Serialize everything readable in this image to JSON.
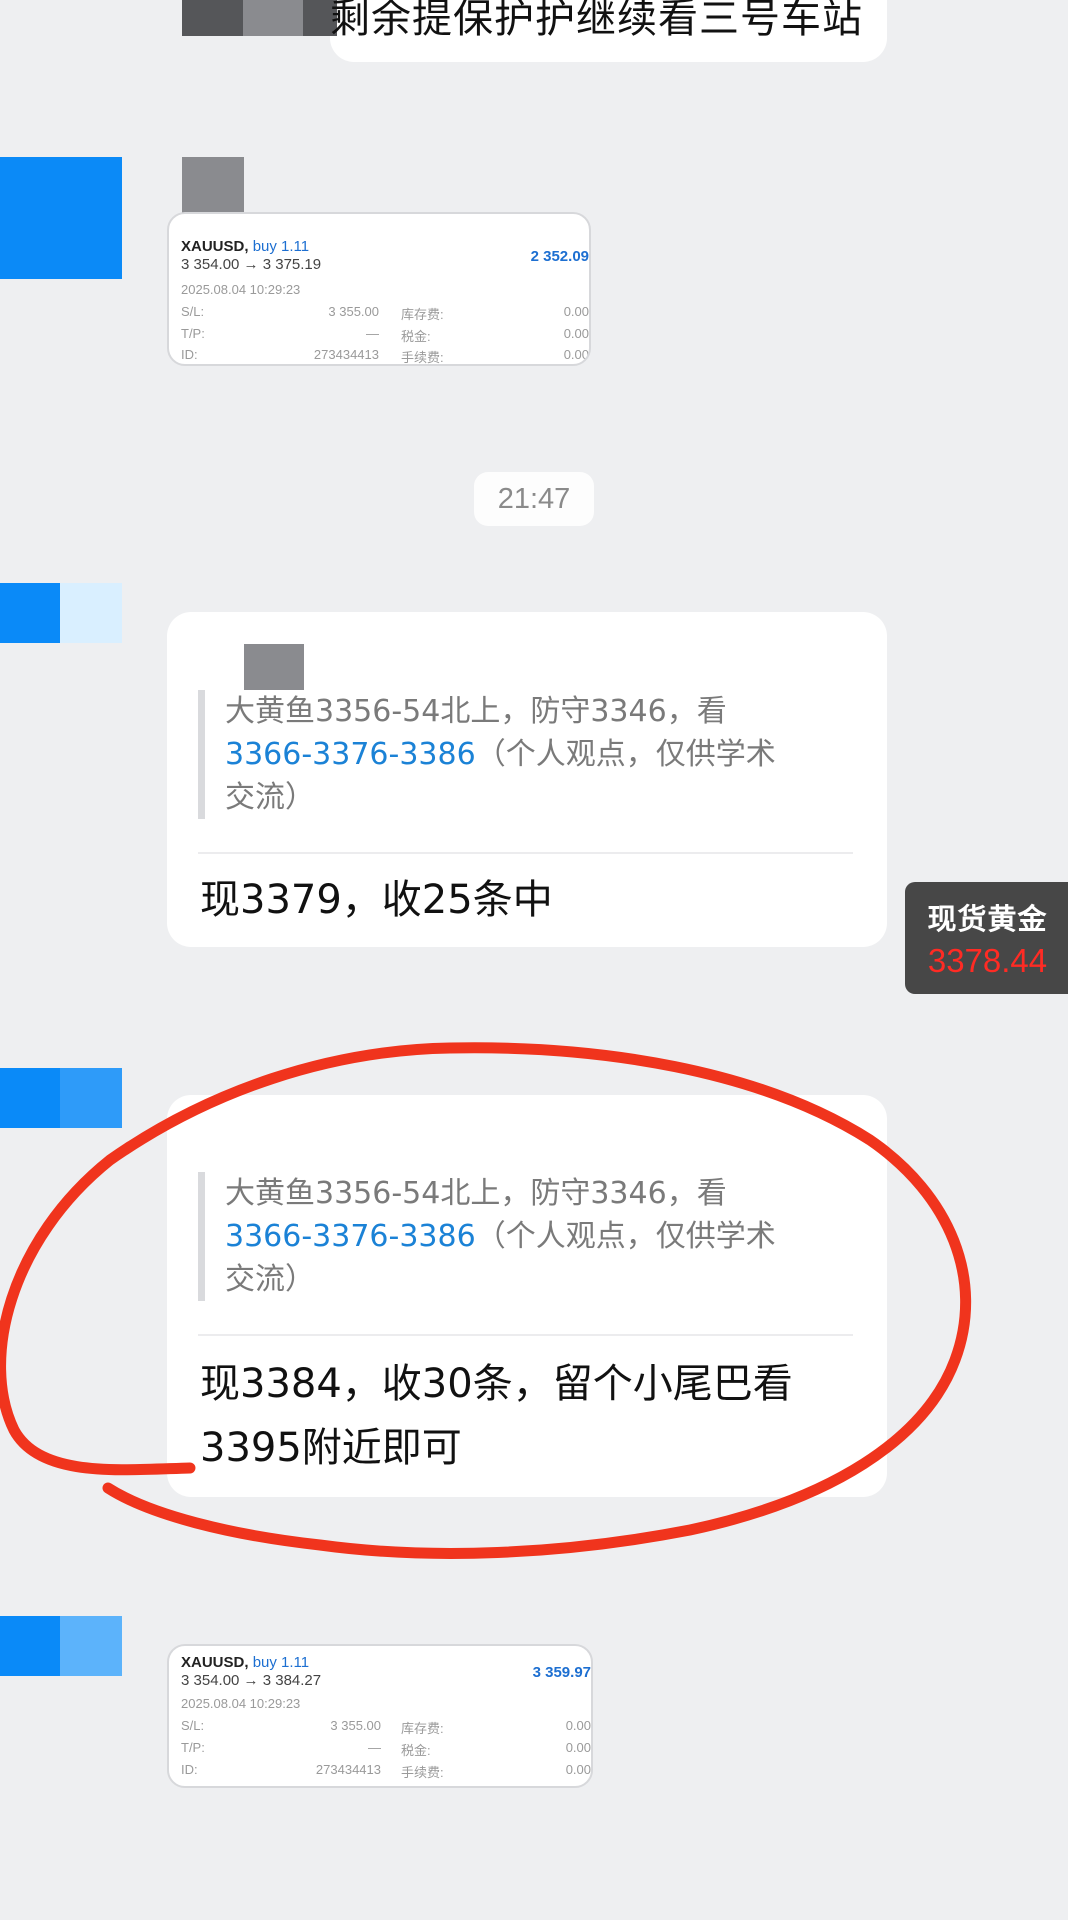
{
  "top_message": {
    "text": "剩余提保护护继续看三号车站"
  },
  "trade_card_1": {
    "symbol": "XAUUSD,",
    "side": "buy 1.11",
    "price": "3 354.00 → 3 375.19",
    "profit": "2 352.09",
    "date": "2025.08.04 10:29:23",
    "rows": [
      {
        "k1": "S/L:",
        "v1": "3 355.00",
        "k2": "库存费:",
        "v2": "0.00"
      },
      {
        "k1": "T/P:",
        "v1": "—",
        "k2": "税金:",
        "v2": "0.00"
      },
      {
        "k1": "ID:",
        "v1": "273434413",
        "k2": "手续费:",
        "v2": "0.00"
      }
    ]
  },
  "time_divider": {
    "time": "21:47"
  },
  "reply_1": {
    "quote_line1": "大黄鱼3356-54北上，防守3346，看",
    "quote_highlight": "3366-3376-3386",
    "quote_rest": "（个人观点，仅供学术",
    "quote_line3": "交流）",
    "text": "现3379，收25条中"
  },
  "gold_ticker": {
    "label": "现货黄金",
    "value": "3378.44",
    "label_color": "#ffffff",
    "value_color": "#ff2b24"
  },
  "reply_2": {
    "quote_line1": "大黄鱼3356-54北上，防守3346，看",
    "quote_highlight": "3366-3376-3386",
    "quote_rest": "（个人观点，仅供学术",
    "quote_line3": "交流）",
    "text_line1": "现3384，收30条，留个小尾巴看",
    "text_line2": "3395附近即可"
  },
  "trade_card_2": {
    "symbol": "XAUUSD,",
    "side": "buy 1.11",
    "price": "3 354.00 → 3 384.27",
    "profit": "3 359.97",
    "date": "2025.08.04 10:29:23",
    "rows": [
      {
        "k1": "S/L:",
        "v1": "3 355.00",
        "k2": "库存费:",
        "v2": "0.00"
      },
      {
        "k1": "T/P:",
        "v1": "—",
        "k2": "税金:",
        "v2": "0.00"
      },
      {
        "k1": "ID:",
        "v1": "273434413",
        "k2": "手续费:",
        "v2": "0.00"
      }
    ]
  },
  "colors": {
    "background": "#eeeff1",
    "avatar_blue": "#0b8af7",
    "link_blue": "#1b82d6",
    "marker_red": "#f0341d"
  }
}
